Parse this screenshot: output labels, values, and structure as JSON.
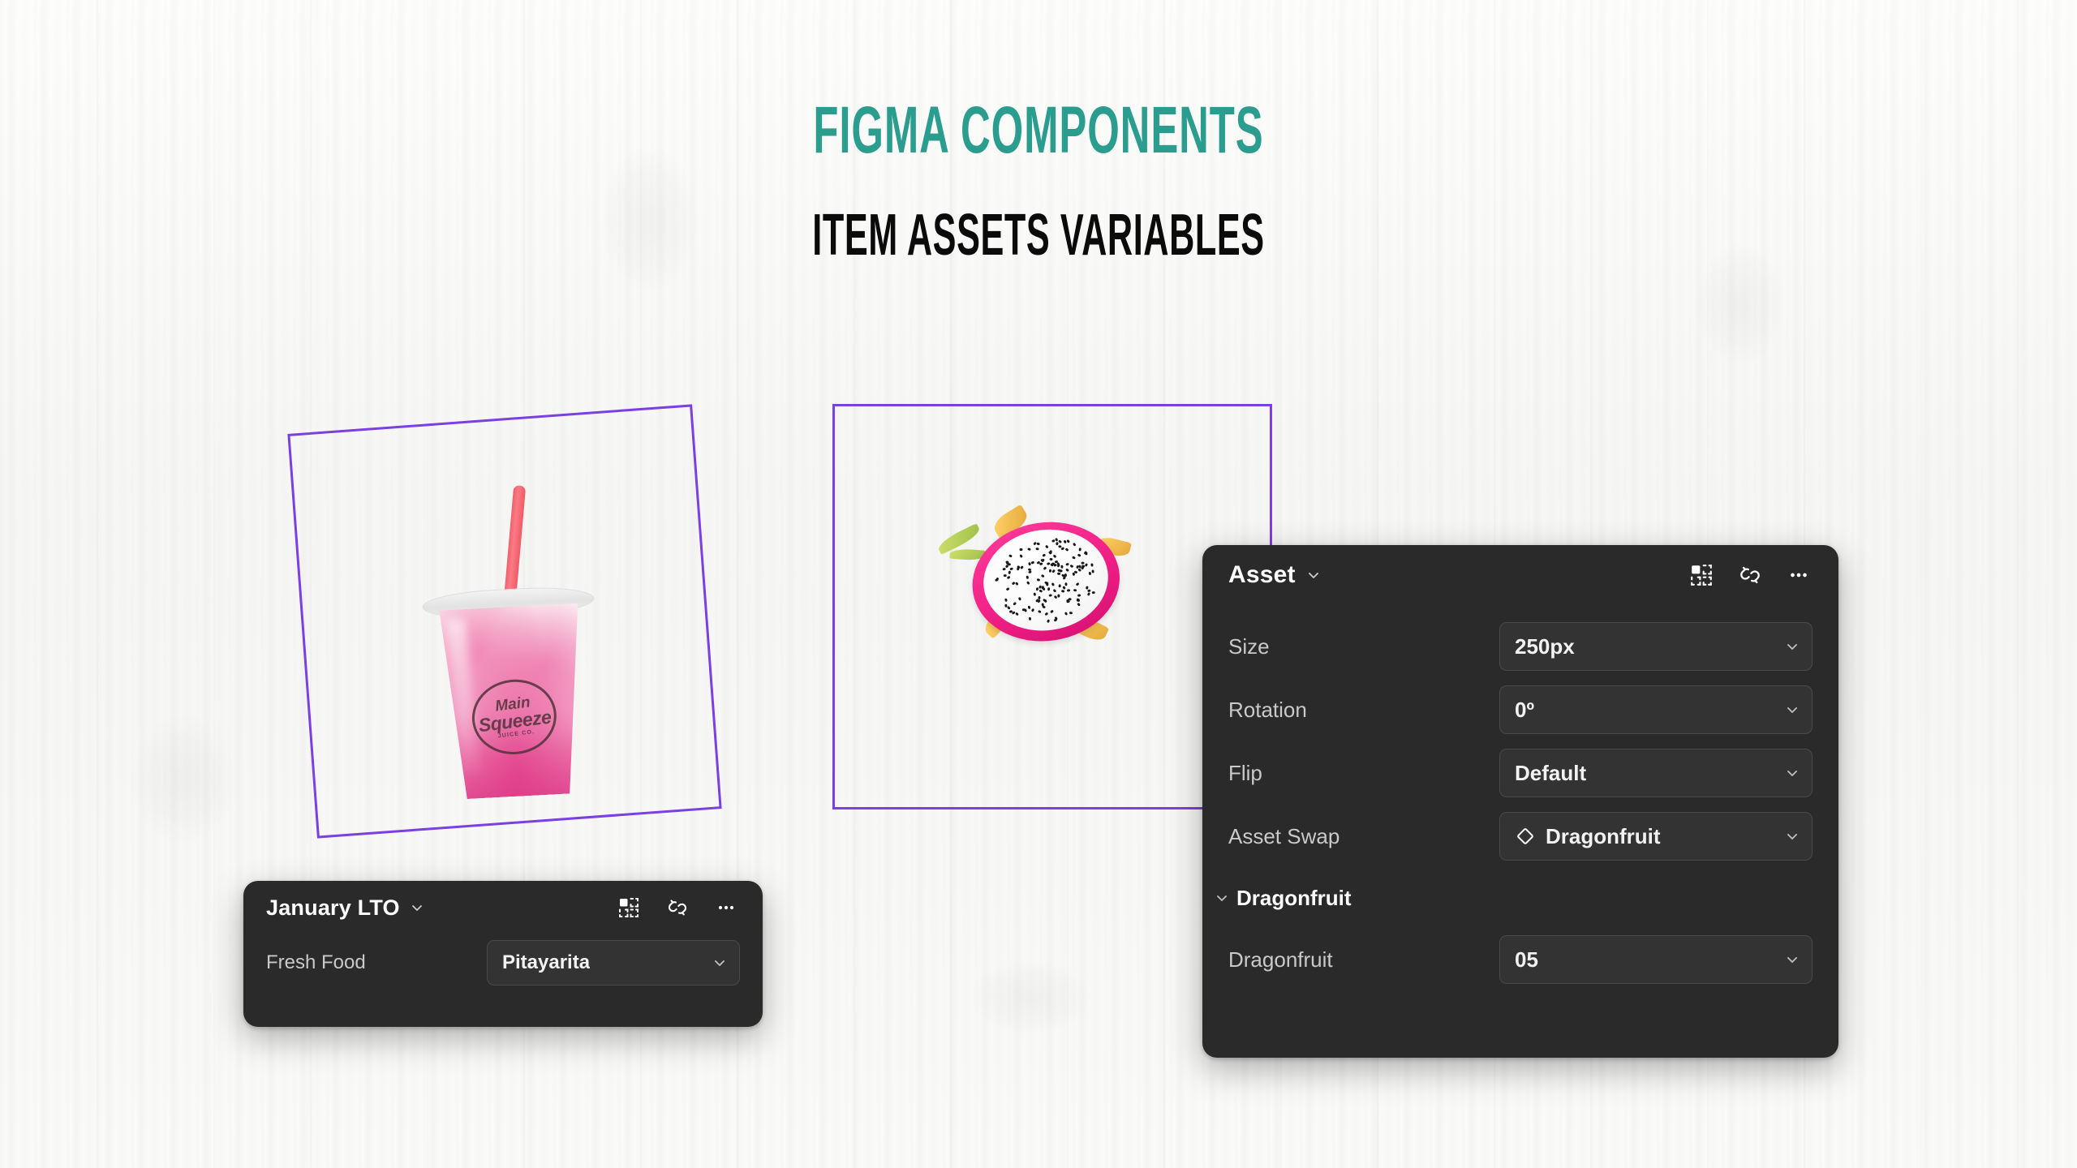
{
  "headings": {
    "main_title": "FIGMA COMPONENTS",
    "sub_title": "ITEM ASSETS VARIABLES"
  },
  "colors": {
    "title_teal": "#2a9d8f",
    "sub_title_black": "#0b0b0b",
    "selection_purple": "#7b3fe4",
    "panel_dark": "#2a2a2a",
    "field_dark": "#333333",
    "label_gray": "#c9c9c9",
    "value_white": "#f2f2f2",
    "background": "#fbfbfa"
  },
  "canvas": {
    "left_frame": {
      "name": "left-selection-frame",
      "artwork": {
        "name": "smoothie-cup",
        "brand_line_1": "Main",
        "brand_line_2": "Squeeze",
        "brand_line_3": "JUICE CO."
      }
    },
    "right_frame": {
      "name": "right-selection-frame",
      "artwork": {
        "name": "dragonfruit-slice"
      }
    }
  },
  "lto_panel": {
    "title": "January LTO",
    "header_icons": [
      {
        "name": "component-icon",
        "label": "Component"
      },
      {
        "name": "detach-instance-icon",
        "label": "Detach instance"
      },
      {
        "name": "more-options-icon",
        "label": "More options"
      }
    ],
    "rows": [
      {
        "label": "Fresh Food",
        "value": "Pitayarita",
        "control": "dropdown"
      }
    ]
  },
  "asset_panel": {
    "title": "Asset",
    "header_icons": [
      {
        "name": "component-icon",
        "label": "Component"
      },
      {
        "name": "detach-instance-icon",
        "label": "Detach instance"
      },
      {
        "name": "more-options-icon",
        "label": "More options"
      }
    ],
    "rows": [
      {
        "label": "Size",
        "value": "250px",
        "control": "dropdown",
        "icon": null
      },
      {
        "label": "Rotation",
        "value": "0º",
        "control": "dropdown",
        "icon": null
      },
      {
        "label": "Flip",
        "value": "Default",
        "control": "dropdown",
        "icon": null
      },
      {
        "label": "Asset Swap",
        "value": "Dragonfruit",
        "control": "dropdown",
        "icon": "instance-diamond-icon"
      }
    ],
    "section": {
      "title": "Dragonfruit",
      "expanded": true,
      "rows": [
        {
          "label": "Dragonfruit",
          "value": "05",
          "control": "dropdown",
          "icon": null
        }
      ]
    }
  }
}
